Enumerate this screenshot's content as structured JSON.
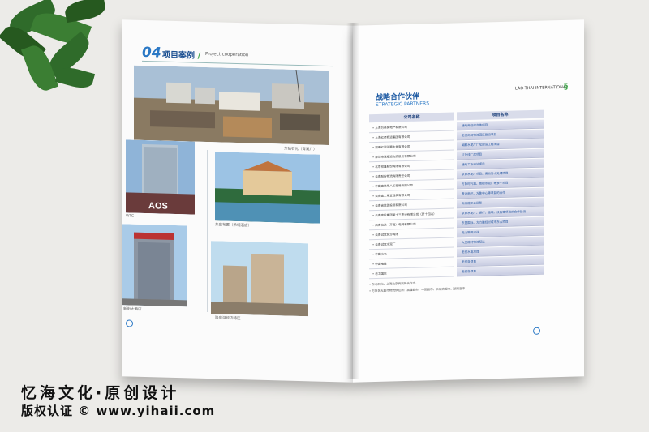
{
  "left_page": {
    "section_number": "04",
    "section_title": "项目案例",
    "section_slash": "/",
    "section_subtitle": "Project cooperation",
    "captions": {
      "top": "东钻石化（青溪厂）",
      "wtc": "WTC",
      "resort": "东盛布置（希缅酒店）",
      "hotel": "新街大酒店",
      "towers": "隆盛湖经济特区"
    }
  },
  "right_page": {
    "header": "LAO-THAI INTERNATIONAL",
    "title": "战略合作伙伴",
    "subtitle": "STRATEGIC PARTNERS",
    "col_company": "公司名称",
    "col_project": "项目名称",
    "rows": [
      {
        "company": "• 上海万泰房地产有限公司",
        "project": "缅甸商住综合体项目"
      },
      {
        "company": "• 上海红帝辉运集团有限公司",
        "project": "老挝商贸物流园区建设项目"
      },
      {
        "company": "• 昆明红河湖鹏大发有限公司",
        "project": "湖鹏水泥厂厂址建设工程项目"
      },
      {
        "company": "• 深圳市深康运物流股份有限公司",
        "project": "红外线厂房项目"
      },
      {
        "company": "• 北京祥盛股份有限有限公司",
        "project": "缅甸工业电站项目"
      },
      {
        "company": "• 云南股份物流有限责任公司",
        "project": "京象水泥厂项目、南坊污水处理项目"
      },
      {
        "company": "• 中国建筑第八工程局有限公司",
        "project": "万象时代城、南梯水泥厂等多个项目"
      },
      {
        "company": "• 云南建工第五建筑有限公司",
        "project": "青运商厅、万象中心等项目的合作"
      },
      {
        "company": "• 云南省旅游投资有限公司",
        "project": "商务建工五区型"
      },
      {
        "company": "• 云南建投集团第十三建设有限公司（原十四冶）",
        "project": "京象水泥厂、银行、建筑、设备等项目的合作建设"
      },
      {
        "company": "• 西南化达（开昌）电网有限公司",
        "project": "东盟国际、大力鹏经过城市东大项目"
      },
      {
        "company": "• 云南试宽充沙有限",
        "project": "电力物资运送"
      },
      {
        "company": "• 云南试宽水泥厂",
        "project": "大型建材物流配送"
      },
      {
        "company": "• 中国水电",
        "project": "老挝水电项目"
      },
      {
        "company": "• 中国电建",
        "project": "老挝各项目"
      },
      {
        "company": "• 老工国际",
        "project": "老挝各项目"
      }
    ],
    "notes": [
      "• 东北石化、上海北京商贸的合作方。",
      "• 万象各大超市物流供应商：昌盛超市、中国超市、长城商超市、湖南超市"
    ]
  },
  "watermark": {
    "line1": "忆海文化·原创设计",
    "line2": "版权认证 © www.yihaii.com"
  },
  "colors": {
    "accent_blue": "#2a78c5",
    "title_blue": "#1d5aa3",
    "table_header": "#d9dcea",
    "logo_green": "#3fa84a"
  }
}
